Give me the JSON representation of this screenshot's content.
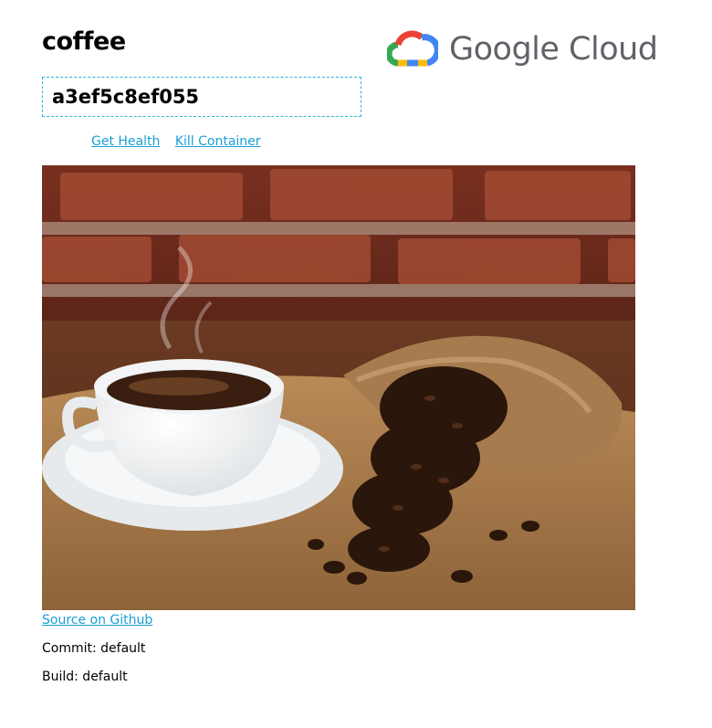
{
  "page": {
    "title": "coffee",
    "brand": "Google Cloud",
    "brand_icon": "google-cloud-logo-icon",
    "hostname": "a3ef5c8ef055"
  },
  "links": {
    "get_health": "Get Health",
    "kill_container": "Kill Container",
    "source": "Source on Github"
  },
  "image": {
    "subject": "coffee-cup-and-beans-photo"
  },
  "footer": {
    "commit": "Commit: default",
    "build": "Build: default"
  },
  "colors": {
    "link": "#1a9fd6",
    "box_border": "#29b6d8",
    "brand_text": "#5f6368",
    "gc_blue": "#4285f4",
    "gc_red": "#ea4335",
    "gc_yellow": "#fbbc04",
    "gc_green": "#34a853"
  }
}
